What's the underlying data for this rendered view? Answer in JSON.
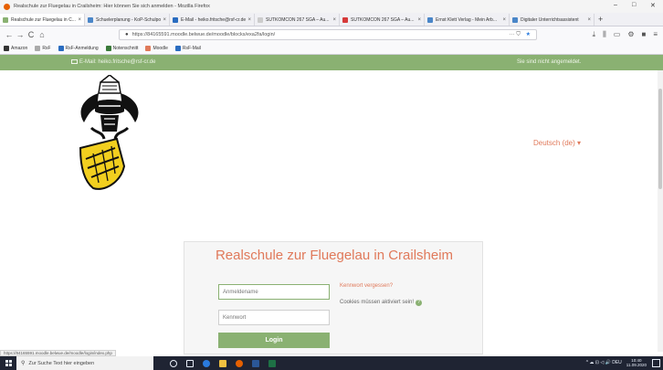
{
  "window": {
    "title": "Realschule zur Fluegelau in Crailsheim: Hier können Sie sich anmelden - Mozilla Firefox",
    "minimize": "–",
    "maximize": "□",
    "close": "✕"
  },
  "tabs": [
    {
      "label": "Realschule zur Fluegelau in C...",
      "color": "#8ab172",
      "active": true
    },
    {
      "label": "Schuelerplanung - KoP-Schulportal",
      "color": "#4a86c8"
    },
    {
      "label": "E-Mail - heiko.fritsche@rsf-cr.de",
      "color": "#2a6cc0"
    },
    {
      "label": "SUTKOMCON 267 SGA – Au...",
      "color": "#cccccc"
    },
    {
      "label": "SUTKOMCON 267 SGA – Au...",
      "color": "#d63a3a"
    },
    {
      "label": "Ernst Klett Verlag - Mein Arb...",
      "color": "#4a86c8"
    },
    {
      "label": "Digitaler Unterrichtsassistent",
      "color": "#4a86c8"
    }
  ],
  "nav": {
    "back": "←",
    "forward": "→",
    "reload": "C",
    "home": "⌂",
    "url": "https://84165591.moodle.belwue.de/moodle/blocks/exa2fa/login/",
    "lock": "🔒",
    "page_actions": "···",
    "pocket": "⛉",
    "bookmark_star": "★",
    "right_icons": [
      "⤓",
      "⫼",
      "▭",
      "⚙",
      "■",
      "≡"
    ]
  },
  "bookmarks": [
    {
      "label": "Amazon",
      "color": "#333333"
    },
    {
      "label": "RsF",
      "color": "#aaaaaa"
    },
    {
      "label": "RsF-Anmeldung",
      "color": "#2a6cc0"
    },
    {
      "label": "Notenschnitt",
      "color": "#3a7a3a"
    },
    {
      "label": "Moodle",
      "color": "#e0795a"
    },
    {
      "label": "RsF-Mail",
      "color": "#2a6cc0"
    }
  ],
  "header": {
    "email_text": "E-Mail: heiko.fritsche@rsf-cr.de",
    "not_logged_in": "Sie sind nicht angemeldet."
  },
  "language": {
    "selected": "Deutsch (de)",
    "caret": "▾"
  },
  "login": {
    "school_name": "Realschule zur Fluegelau in Crailsheim",
    "username_placeholder": "Anmeldename",
    "password_placeholder": "Kennwort",
    "login_button": "Login",
    "forgot_link": "Kennwort vergessen?",
    "cookies_text": "Cookies müssen aktiviert sein!",
    "help_icon": "?"
  },
  "status_url": "https://84165591.moodle.belwue.de/moodle/login/index.php",
  "taskbar": {
    "search_placeholder": "Zur Suche Text hier eingeben",
    "search_icon": "⚲",
    "tray_text": "^ ☁ ⊡ ◁ 🔊 DEU",
    "time": "10:40",
    "date": "11.09.2020",
    "app_icons": [
      {
        "name": "cortana-icon",
        "color": "#e8eef8"
      },
      {
        "name": "task-view-icon",
        "color": "#e8eef8"
      },
      {
        "name": "edge-icon",
        "color": "#2a7bde"
      },
      {
        "name": "file-explorer-icon",
        "color": "#f0c040"
      },
      {
        "name": "firefox-icon",
        "color": "#e66000"
      },
      {
        "name": "word-icon",
        "color": "#2b5797"
      },
      {
        "name": "excel-icon",
        "color": "#1e7145"
      }
    ]
  },
  "colors": {
    "moodle_green": "#8ab172",
    "accent_orange": "#e0795a",
    "crest_yellow": "#f2cf1f"
  }
}
